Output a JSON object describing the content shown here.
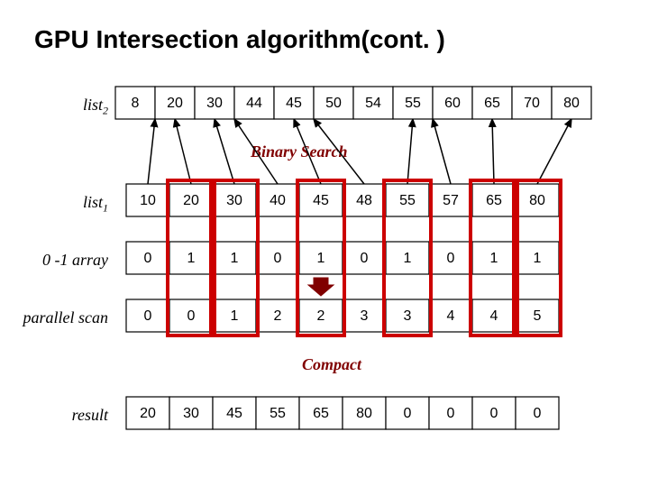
{
  "title": "GPU Intersection algorithm(cont. )",
  "labels": {
    "list2": "list",
    "list2_sub": "2",
    "list1": "list",
    "list1_sub": "1",
    "zero_one": "0 -1 array",
    "parallel_scan": "parallel scan",
    "result": "result"
  },
  "annotations": {
    "binary_search": "Binary Search",
    "compact": "Compact"
  },
  "chart_data": {
    "type": "table",
    "rows": {
      "list2": [
        8,
        20,
        30,
        44,
        45,
        50,
        54,
        55,
        60,
        65,
        70,
        80
      ],
      "list1": [
        10,
        20,
        30,
        40,
        45,
        48,
        55,
        57,
        65,
        80
      ],
      "zero_one": [
        0,
        1,
        1,
        0,
        1,
        0,
        1,
        0,
        1,
        1
      ],
      "parallel_scan": [
        0,
        0,
        1,
        2,
        2,
        3,
        3,
        4,
        4,
        5
      ],
      "result": [
        20,
        30,
        45,
        55,
        65,
        80,
        0,
        0,
        0,
        0
      ]
    },
    "mask_columns": [
      1,
      2,
      4,
      6,
      8,
      9
    ],
    "arrow_col": 4
  }
}
